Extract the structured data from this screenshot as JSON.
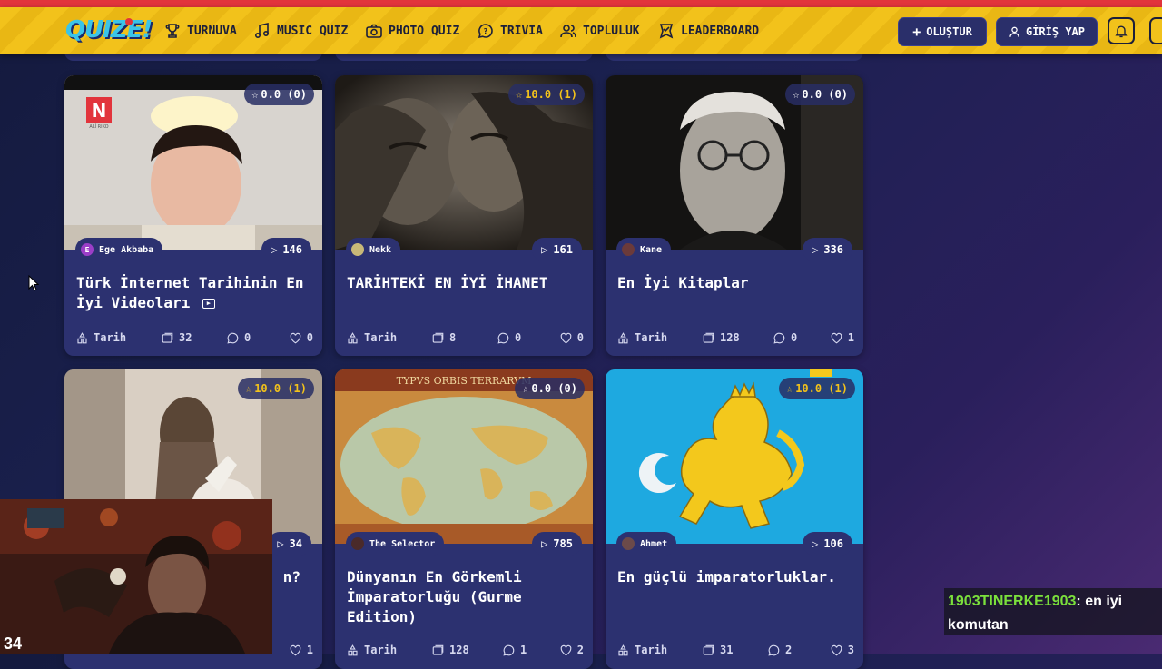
{
  "header": {
    "logo": "QUIZE!",
    "nav": [
      {
        "label": "TURNUVA",
        "icon": "trophy-icon"
      },
      {
        "label": "MUSIC QUIZ",
        "icon": "music-note-icon"
      },
      {
        "label": "PHOTO QUIZ",
        "icon": "camera-icon"
      },
      {
        "label": "TRIVIA",
        "icon": "chat-bubble-icon"
      },
      {
        "label": "TOPLULUK",
        "icon": "users-icon"
      },
      {
        "label": "LEADERBOARD",
        "icon": "badge-icon"
      }
    ],
    "create_label": "OLUŞTUR",
    "login_label": "GİRİŞ YAP"
  },
  "cards": [
    {
      "rating": "0.0 (0)",
      "author": "Ege Akbaba",
      "author_initial": "E",
      "plays": "146",
      "title": "Türk İnternet Tarihinin En İyi Videoları",
      "category": "Tarih",
      "questions": "32",
      "comments": "0",
      "likes": "0"
    },
    {
      "rating": "10.0 (1)",
      "author": "Nekk",
      "plays": "161",
      "title": "TARİHTEKİ EN İYİ İHANET",
      "category": "Tarih",
      "questions": "8",
      "comments": "0",
      "likes": "0"
    },
    {
      "rating": "0.0 (0)",
      "author": "Kane",
      "plays": "336",
      "title": "En İyi Kitaplar",
      "category": "Tarih",
      "questions": "128",
      "comments": "0",
      "likes": "1"
    },
    {
      "rating": "10.0 (1)",
      "author": "",
      "plays": "34",
      "title": "n?",
      "category": "",
      "questions": "",
      "comments": "",
      "likes": "1"
    },
    {
      "rating": "0.0 (0)",
      "author": "The Selector",
      "plays": "785",
      "title": "Dünyanın En Görkemli İmparatorluğu (Gurme Edition)",
      "category": "Tarih",
      "questions": "128",
      "comments": "1",
      "likes": "2"
    },
    {
      "rating": "10.0 (1)",
      "author": "Ahmet",
      "plays": "106",
      "title": "En güçlü imparatorluklar.",
      "category": "Tarih",
      "questions": "31",
      "comments": "2",
      "likes": "3"
    }
  ],
  "thumb_overlays": {
    "news_logo": "N",
    "news_caption": "ALİ RIKO",
    "map_banner": "TYPVS ORBIS TERRARVM"
  },
  "chat": {
    "username": "1903TINERKE1903",
    "message": ": en iyi komutan",
    "username_color": "#7be03c"
  },
  "webcam": {
    "counter": "34"
  },
  "colors": {
    "accent": "#f2c21b",
    "card": "#2c3170",
    "header_stripe": "#e2343c"
  }
}
